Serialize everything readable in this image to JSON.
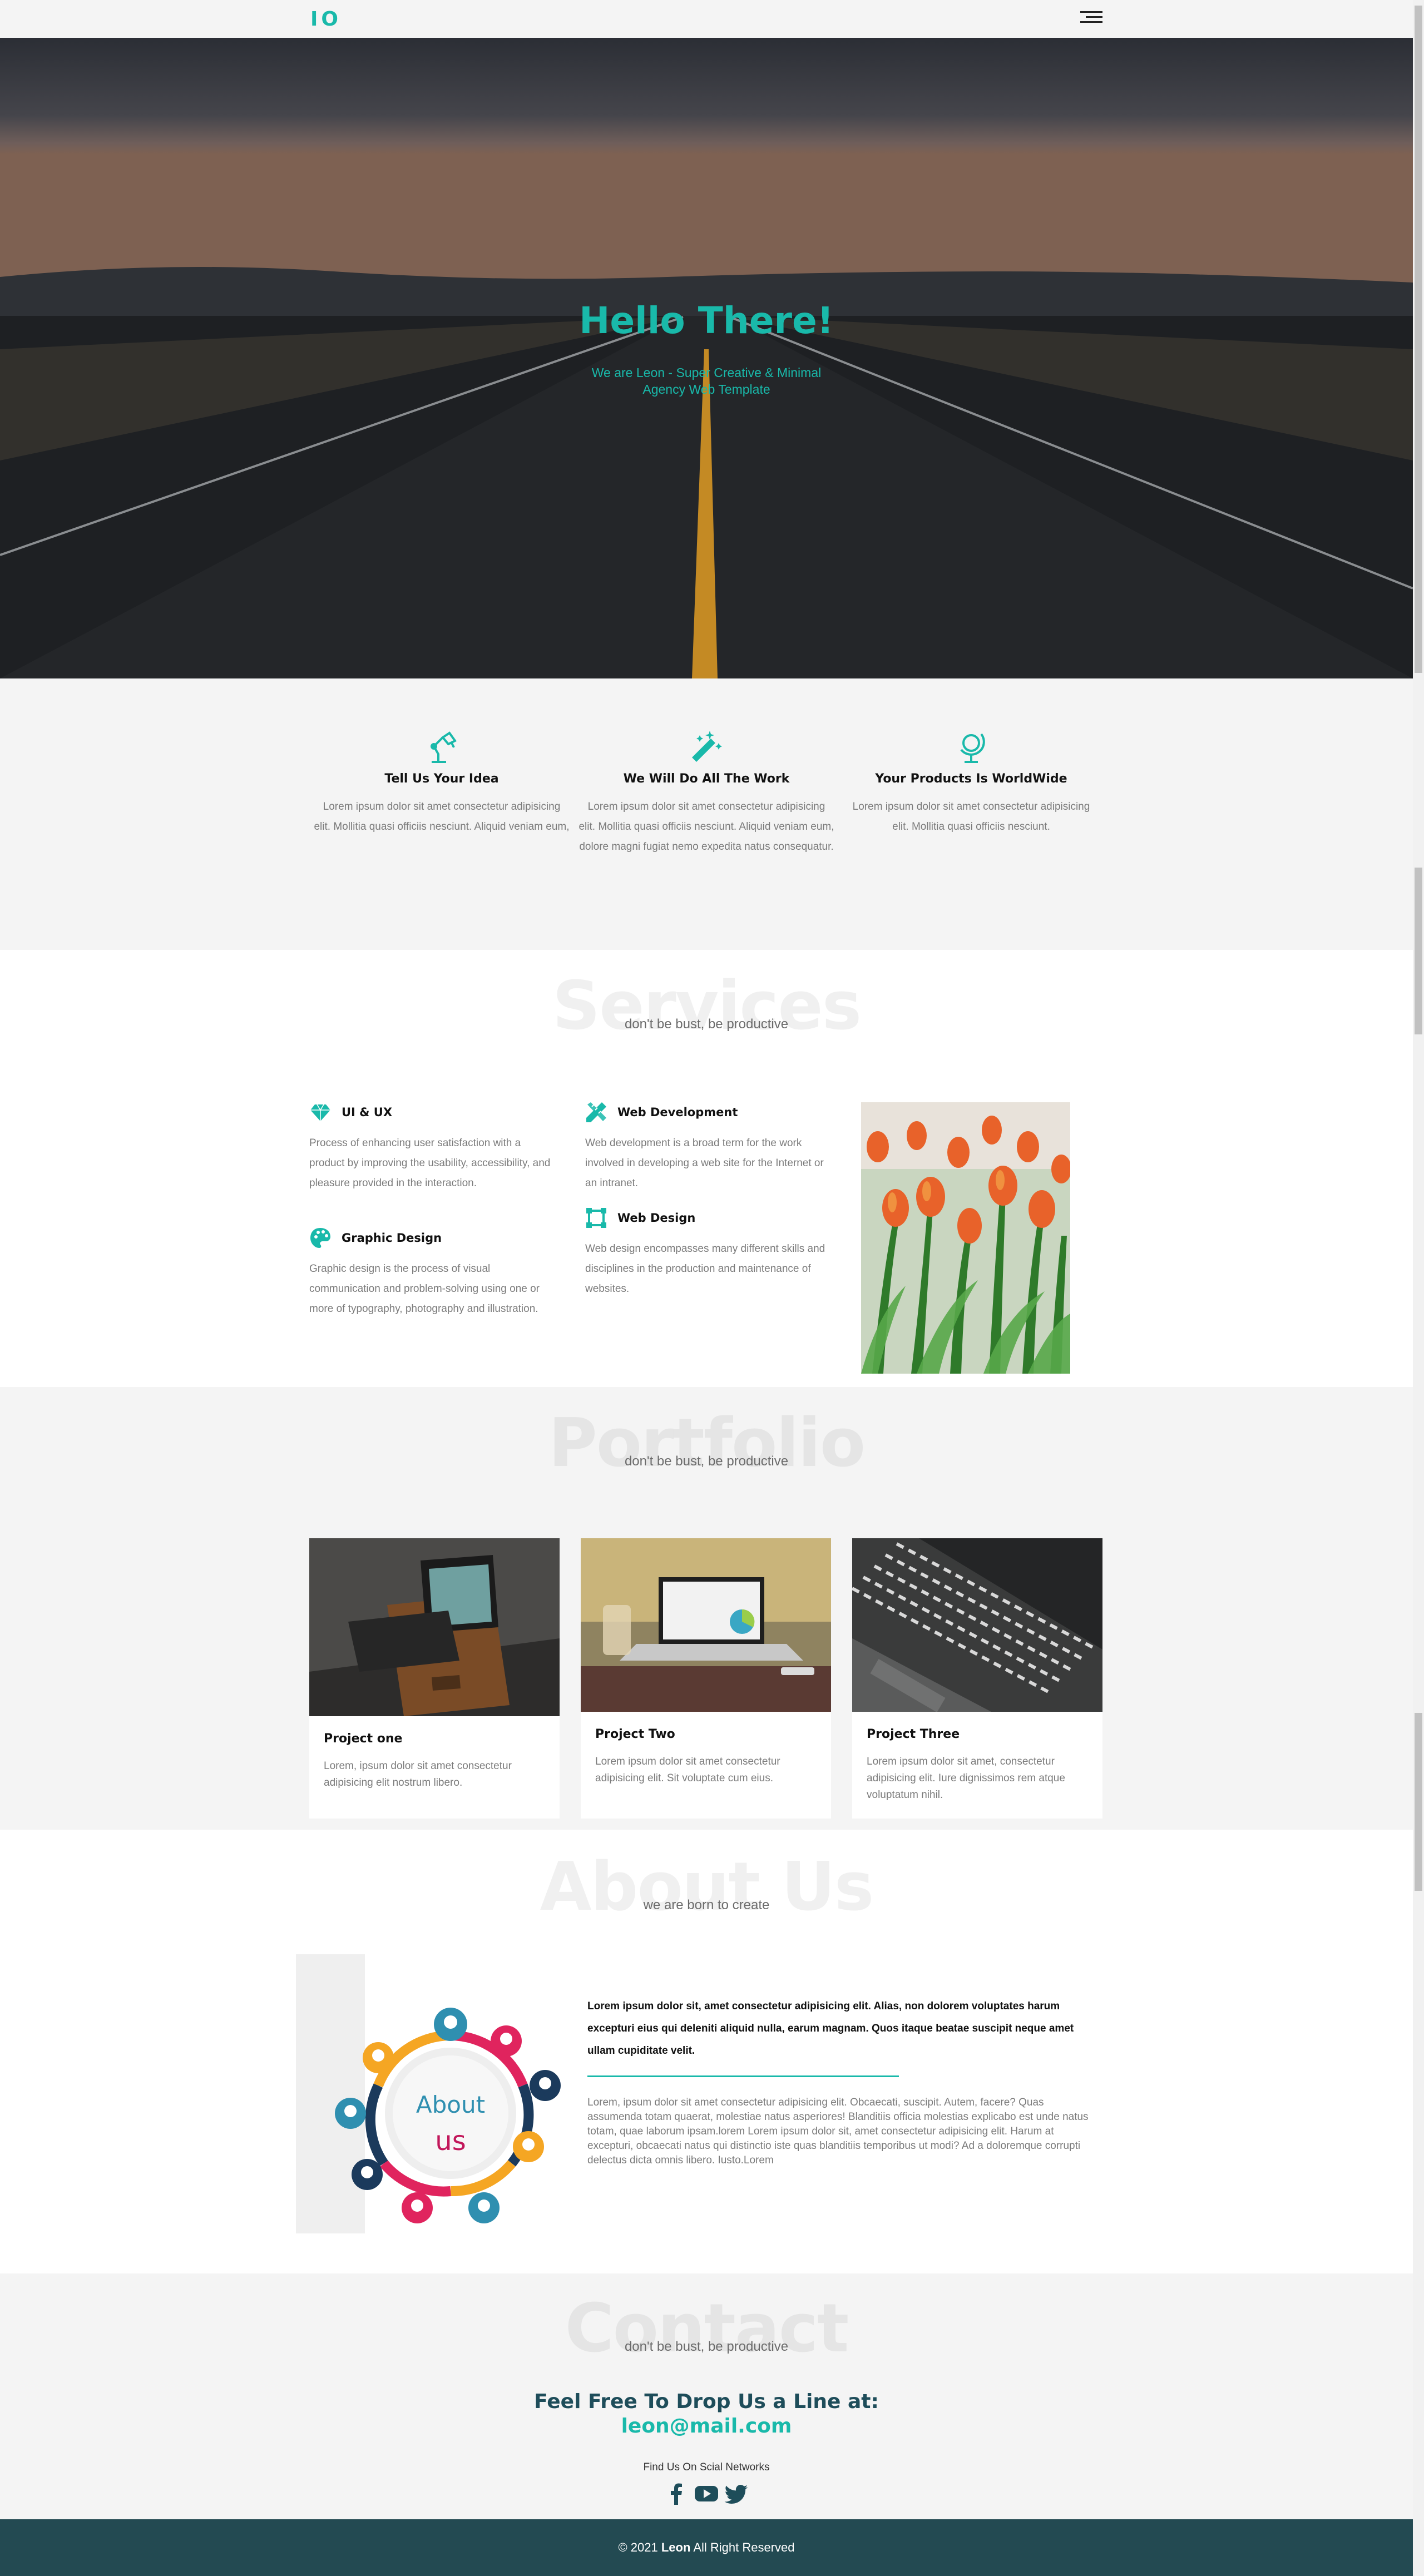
{
  "nav": {
    "logo": "IO",
    "menu_icon": "hamburger-icon"
  },
  "hero": {
    "title": "Hello There!",
    "subtitle": "We are Leon - Super Creative & Minimal Agency Web Template"
  },
  "features": [
    {
      "icon": "lamp-icon",
      "title": "Tell Us Your Idea",
      "text": "Lorem ipsum dolor sit amet consectetur adipisicing elit. Mollitia quasi officiis nesciunt. Aliquid veniam eum,"
    },
    {
      "icon": "magic-wand-icon",
      "title": "We Will Do All The Work",
      "text": "Lorem ipsum dolor sit amet consectetur adipisicing elit. Mollitia quasi officiis nesciunt. Aliquid veniam eum, dolore magni fugiat nemo expedita natus consequatur."
    },
    {
      "icon": "globe-icon",
      "title": "Your Products Is WorldWide",
      "text": "Lorem ipsum dolor sit amet consectetur adipisicing elit. Mollitia quasi officiis nesciunt."
    }
  ],
  "services": {
    "heading": "Services",
    "subheading": "don't be bust, be productive",
    "items": [
      {
        "icon": "diamond-icon",
        "title": "UI & UX",
        "text": "Process of enhancing user satisfaction with a product by improving the usability, accessibility, and pleasure provided in the interaction."
      },
      {
        "icon": "palette-icon",
        "title": "Graphic Design",
        "text": "Graphic design is the process of visual communication and problem-solving using one or more of typography, photography and illustration."
      },
      {
        "icon": "pencil-ruler-icon",
        "title": "Web Development",
        "text": "Web development is a broad term for the work involved in developing a web site for the Internet or an intranet."
      },
      {
        "icon": "vector-square-icon",
        "title": "Web Design",
        "text": "Web design encompasses many different skills and disciplines in the production and maintenance of websites."
      }
    ]
  },
  "portfolio": {
    "heading": "Portfolio",
    "subheading": "don't be bust, be productive",
    "projects": [
      {
        "title": "Project one",
        "text": "Lorem, ipsum dolor sit amet consectetur adipisicing elit nostrum libero."
      },
      {
        "title": "Project Two",
        "text": "Lorem ipsum dolor sit amet consectetur adipisicing elit. Sit voluptate cum eius."
      },
      {
        "title": "Project Three",
        "text": "Lorem ipsum dolor sit amet, consectetur adipisicing elit. Iure dignissimos rem atque voluptatum nihil."
      }
    ]
  },
  "about": {
    "heading": "About Us",
    "subheading": "we are born to create",
    "art_word1": "About",
    "art_word2": "us",
    "bold_text": "Lorem ipsum dolor sit, amet consectetur adipisicing elit. Alias, non dolorem voluptates harum excepturi eius qui deleniti aliquid nulla, earum magnam. Quos itaque beatae suscipit neque amet ullam cupiditate velit.",
    "text": "Lorem, ipsum dolor sit amet consectetur adipisicing elit. Obcaecati, suscipit. Autem, facere? Quas assumenda totam quaerat, molestiae natus asperiores! Blanditiis officia molestias explicabo est unde natus totam, quae laborum ipsam.lorem Lorem ipsum dolor sit, amet consectetur adipisicing elit. Harum at excepturi, obcaecati natus qui distinctio iste quas blanditiis temporibus ut modi? Ad a doloremque corrupti delectus dicta omnis libero. Iusto.Lorem"
  },
  "contact": {
    "heading": "Contact",
    "subheading": "don't be bust, be productive",
    "drop_line": "Feel Free To Drop Us a Line at:",
    "email": "leon@mail.com",
    "find_us": "Find Us On Scial Networks",
    "socials": [
      "facebook-icon",
      "youtube-icon",
      "twitter-icon"
    ]
  },
  "footer": {
    "copyright_prefix": "© 2021 ",
    "brand": "Leon",
    "copyright_suffix": " All Right Reserved"
  },
  "colors": {
    "accent": "#19b9aa",
    "footer_bg": "#234a52",
    "heading_dark": "#1e4d5a",
    "section_gray": "#f4f4f4"
  }
}
